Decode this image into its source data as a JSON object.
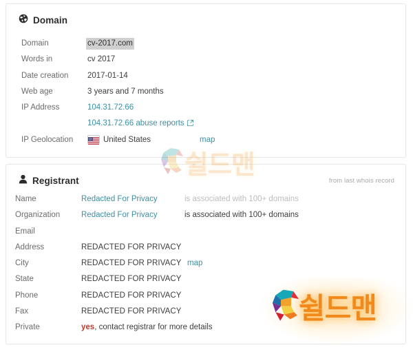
{
  "domain_card": {
    "icon": "globe-icon",
    "title": "Domain",
    "rows": [
      {
        "label": "Domain",
        "value": "cv-2017.com"
      },
      {
        "label": "Words in",
        "value": "cv 2017"
      },
      {
        "label": "Date creation",
        "value": "2017-01-14"
      },
      {
        "label": "Web age",
        "value": "3 years and 7 months"
      },
      {
        "label": "IP Address",
        "value": "104.31.72.66"
      },
      {
        "label": "",
        "value": "104.31.72.66 abuse reports"
      },
      {
        "label": "IP Geolocation",
        "value": "United States"
      }
    ],
    "geolocation": {
      "flag": "us-flag-icon",
      "country": "United States",
      "map_label": "map"
    },
    "abuse_reports_icon": "external-link-icon"
  },
  "registrant_card": {
    "icon": "person-icon",
    "title": "Registrant",
    "note": "from last whois record",
    "rows": [
      {
        "label": "Name",
        "value": "Redacted For Privacy",
        "note": "is associated with 100+ domains"
      },
      {
        "label": "Organization",
        "value": "Redacted For Privacy",
        "note": "is associated with 100+ domains"
      },
      {
        "label": "Email",
        "value": ""
      },
      {
        "label": "Address",
        "value": "REDACTED FOR PRIVACY"
      },
      {
        "label": "City",
        "value": "REDACTED FOR PRIVACY",
        "map_label": "map"
      },
      {
        "label": "State",
        "value": "REDACTED FOR PRIVACY"
      },
      {
        "label": "Phone",
        "value": "REDACTED FOR PRIVACY"
      },
      {
        "label": "Fax",
        "value": "REDACTED FOR PRIVACY"
      },
      {
        "label": "Private",
        "value_emphasis": "yes",
        "value_rest": ", contact registrar for more details"
      }
    ]
  },
  "watermarks": {
    "top": {
      "logo": "shieldman-s-logo",
      "text": "쉴드맨"
    },
    "bottom": {
      "logo": "shieldman-s-logo",
      "text": "쉴드맨"
    }
  },
  "colors": {
    "link": "#3d8fa3",
    "label": "#6b6b6b",
    "value": "#3d3d3d",
    "alert": "#c0392b",
    "card_border": "#e6e6e6",
    "highlight": "#cfcfcf"
  }
}
